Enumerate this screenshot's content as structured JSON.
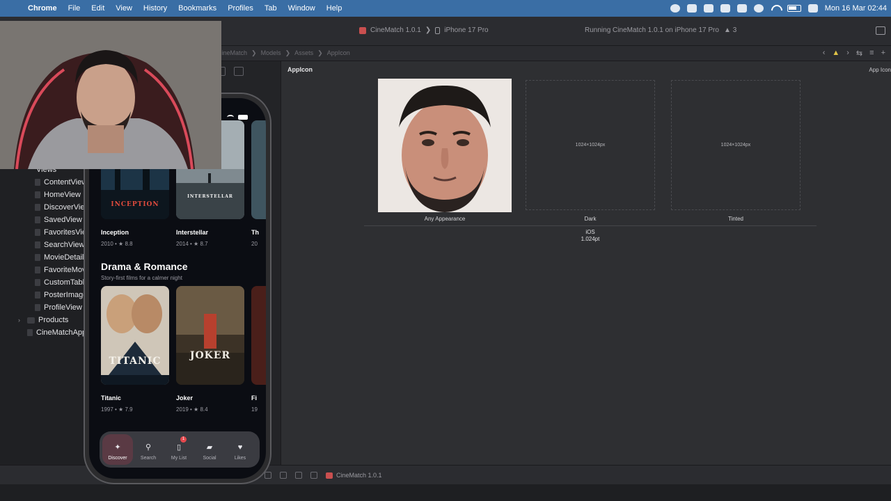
{
  "menubar": {
    "app": "Chrome",
    "items": [
      "File",
      "Edit",
      "View",
      "History",
      "Bookmarks",
      "Profiles",
      "Tab",
      "Window",
      "Help"
    ],
    "clock": "Mon 16 Mar  02:44",
    "accent_color": "#3a6ea5"
  },
  "toolbar": {
    "scheme": "CineMatch 1.0.1",
    "destination": "iPhone 17 Pro",
    "run_status": "Running CineMatch 1.0.1 on iPhone 17 Pro",
    "warning_count": "3"
  },
  "jumpbar": {
    "crumbs": [
      "CineMatch",
      "Models",
      "Assets",
      "AppIcon"
    ]
  },
  "navigator": {
    "group": "Views",
    "files": [
      "ContentView",
      "HomeView",
      "DiscoverView",
      "SavedView",
      "FavoritesView",
      "SearchView",
      "MovieDetail",
      "FavoriteMov",
      "CustomTabl",
      "PosterImage",
      "ProfileView"
    ],
    "products": "Products",
    "app_file": "CineMatchApp"
  },
  "editor": {
    "title": "AppIcon",
    "right_label": "App Icon",
    "slots": [
      {
        "label": "Any Appearance",
        "size_text": ""
      },
      {
        "label": "Dark",
        "size_text": "1024×1024px"
      },
      {
        "label": "Tinted",
        "size_text": "1024×1024px"
      }
    ],
    "platform": "iOS",
    "point_size": "1.024pt"
  },
  "simulator": {
    "row1": [
      {
        "title": "Inception",
        "year": "2010",
        "rating": "8.8",
        "poster_text": "INCEPTION"
      },
      {
        "title": "Interstellar",
        "year": "2014",
        "rating": "8.7",
        "poster_text": "INTERSTELLAR"
      },
      {
        "title": "Th",
        "meta": "20"
      }
    ],
    "section": {
      "title": "Drama & Romance",
      "subtitle": "Story-first films for a calmer night"
    },
    "row2": [
      {
        "title": "Titanic",
        "year": "1997",
        "rating": "7.9",
        "poster_text": "TITANIC"
      },
      {
        "title": "Joker",
        "year": "2019",
        "rating": "8.4",
        "poster_text": "JOKER"
      },
      {
        "title": "Fi",
        "meta": "19"
      }
    ],
    "tabs": [
      {
        "label": "Discover",
        "icon": "sparkles-icon",
        "active": true
      },
      {
        "label": "Search",
        "icon": "search-icon"
      },
      {
        "label": "My List",
        "icon": "bookmark-icon",
        "badge": "1"
      },
      {
        "label": "Social",
        "icon": "chat-bubbles-icon"
      },
      {
        "label": "Likes",
        "icon": "heart-icon"
      }
    ]
  },
  "debugbar": {
    "process": "CineMatch 1.0.1"
  }
}
